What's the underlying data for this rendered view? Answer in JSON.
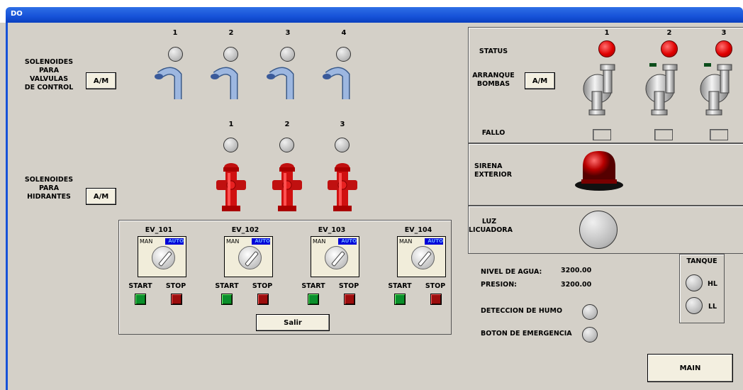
{
  "window": {
    "title": "DO"
  },
  "valves": {
    "label": "SOLENOIDES\nPARA\nVALVULAS\nDE CONTROL",
    "mode_button": "A/M",
    "numbers": [
      "1",
      "2",
      "3",
      "4"
    ]
  },
  "hydrants": {
    "label": "SOLENOIDES\nPARA\nHIDRANTES",
    "mode_button": "A/M",
    "numbers": [
      "1",
      "2",
      "3"
    ]
  },
  "ev_panel": {
    "units": [
      {
        "name": "EV_101",
        "man": "MAN",
        "auto": "AUTO",
        "start": "START",
        "stop": "STOP"
      },
      {
        "name": "EV_102",
        "man": "MAN",
        "auto": "AUTO",
        "start": "START",
        "stop": "STOP"
      },
      {
        "name": "EV_103",
        "man": "MAN",
        "auto": "AUTO",
        "start": "START",
        "stop": "STOP"
      },
      {
        "name": "EV_104",
        "man": "MAN",
        "auto": "AUTO",
        "start": "START",
        "stop": "STOP"
      }
    ],
    "exit_button": "Salir"
  },
  "pumps": {
    "status_label": "STATUS",
    "start_label": "ARRANQUE\nBOMBAS",
    "mode_button": "A/M",
    "fault_label": "FALLO",
    "numbers": [
      "1",
      "2",
      "3"
    ]
  },
  "siren": {
    "label": "SIRENA\nEXTERIOR"
  },
  "blender_light": {
    "label": "LUZ\nLICUADORA"
  },
  "readings": {
    "water_level_label": "NIVEL DE AGUA:",
    "water_level_value": "3200.00",
    "pressure_label": "PRESION:",
    "pressure_value": "3200.00",
    "smoke_label": "DETECCION DE HUMO",
    "emergency_label": "BOTON DE EMERGENCIA"
  },
  "tank": {
    "title": "TANQUE",
    "high": "HL",
    "low": "LL"
  },
  "main_button": "MAIN",
  "colors": {
    "title_bar": "#1652d8",
    "status_on": "#e00000",
    "start": "#0a8f2c",
    "stop": "#9c0d0d",
    "hydrant": "#d01010",
    "pipe": "#9db7e0"
  }
}
